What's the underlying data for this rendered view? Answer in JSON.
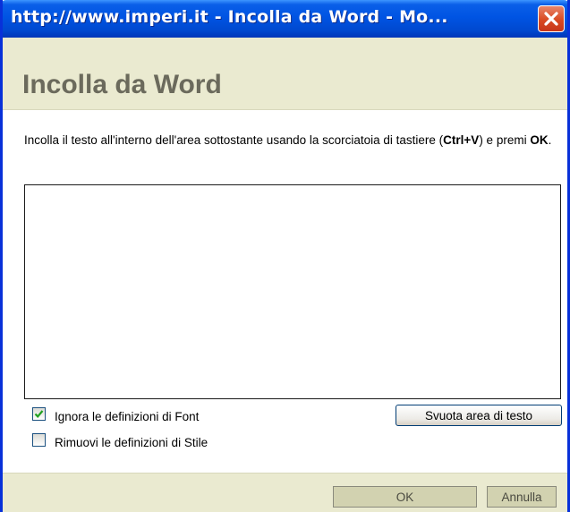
{
  "window": {
    "title": "http://www.imperi.it - Incolla da Word - Mo...",
    "close_icon": "close-icon"
  },
  "dialog": {
    "heading": "Incolla da Word",
    "instruction_part1": "Incolla il testo all'interno dell'area sottostante usando la scorciatoia di tastiere (",
    "instruction_shortcut": "Ctrl+V",
    "instruction_part2": ") e premi ",
    "instruction_ok": "OK",
    "instruction_part3": ".",
    "paste_area_value": ""
  },
  "options": {
    "ignore_font": {
      "label": "Ignora le definizioni di Font",
      "checked": true
    },
    "remove_style": {
      "label": "Rimuovi le definizioni di Stile",
      "checked": false
    }
  },
  "buttons": {
    "clear": "Svuota area di testo",
    "ok": "OK",
    "cancel": "Annulla"
  },
  "colors": {
    "titlebar": "#0054e3",
    "panel": "#eaead0",
    "close": "#d94a22"
  }
}
